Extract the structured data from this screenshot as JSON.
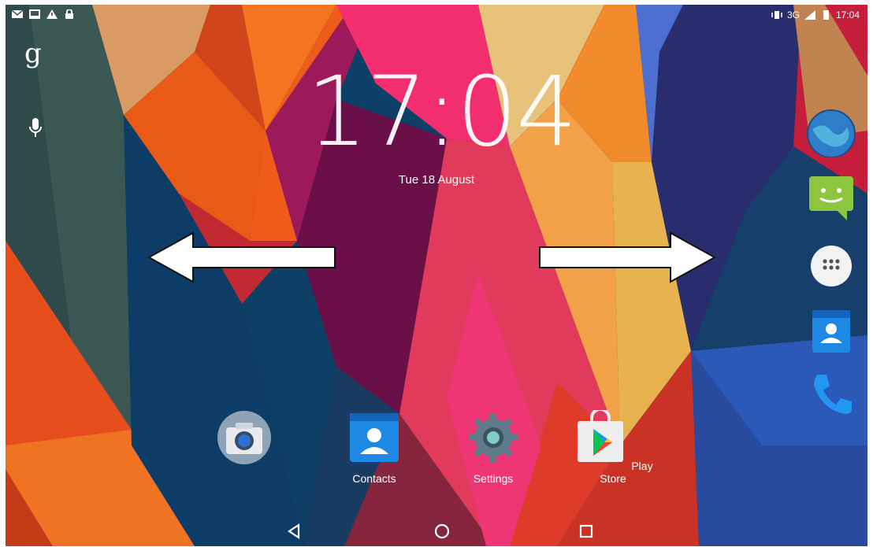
{
  "status_bar": {
    "time": "17:04",
    "network": "3G",
    "left_icons": [
      "mail-icon",
      "image-icon",
      "warning-icon",
      "lock-icon"
    ],
    "right_icons": [
      "vibrate-icon",
      "signal-icon",
      "battery-icon"
    ]
  },
  "lockscreen": {
    "clock": "17:04",
    "date": "Tue 18 August"
  },
  "left_bar": {
    "search_glyph": "g",
    "voice_icon": "microphone-icon"
  },
  "dock": {
    "apps": [
      {
        "name": "",
        "icon": "camera-icon"
      },
      {
        "name": "Contacts",
        "icon": "contacts-icon"
      },
      {
        "name": "Settings",
        "icon": "settings-icon"
      },
      {
        "name": "Play Store",
        "icon": "play-store-icon"
      }
    ]
  },
  "right_column": {
    "icons": [
      "browser-icon",
      "messaging-icon",
      "app-drawer-icon",
      "contacts-icon",
      "phone-icon"
    ]
  },
  "overlay": {
    "arrows": [
      "left-arrow",
      "right-arrow"
    ]
  },
  "navigation": {
    "buttons": [
      "back-button",
      "home-button",
      "recents-button"
    ]
  },
  "colors": {
    "deep_blue": "#0e3f66",
    "orange": "#f36c1e",
    "pink": "#ec2a67",
    "magenta": "#6e1048",
    "gold": "#e9b14e",
    "navy": "#2a2d6d"
  }
}
